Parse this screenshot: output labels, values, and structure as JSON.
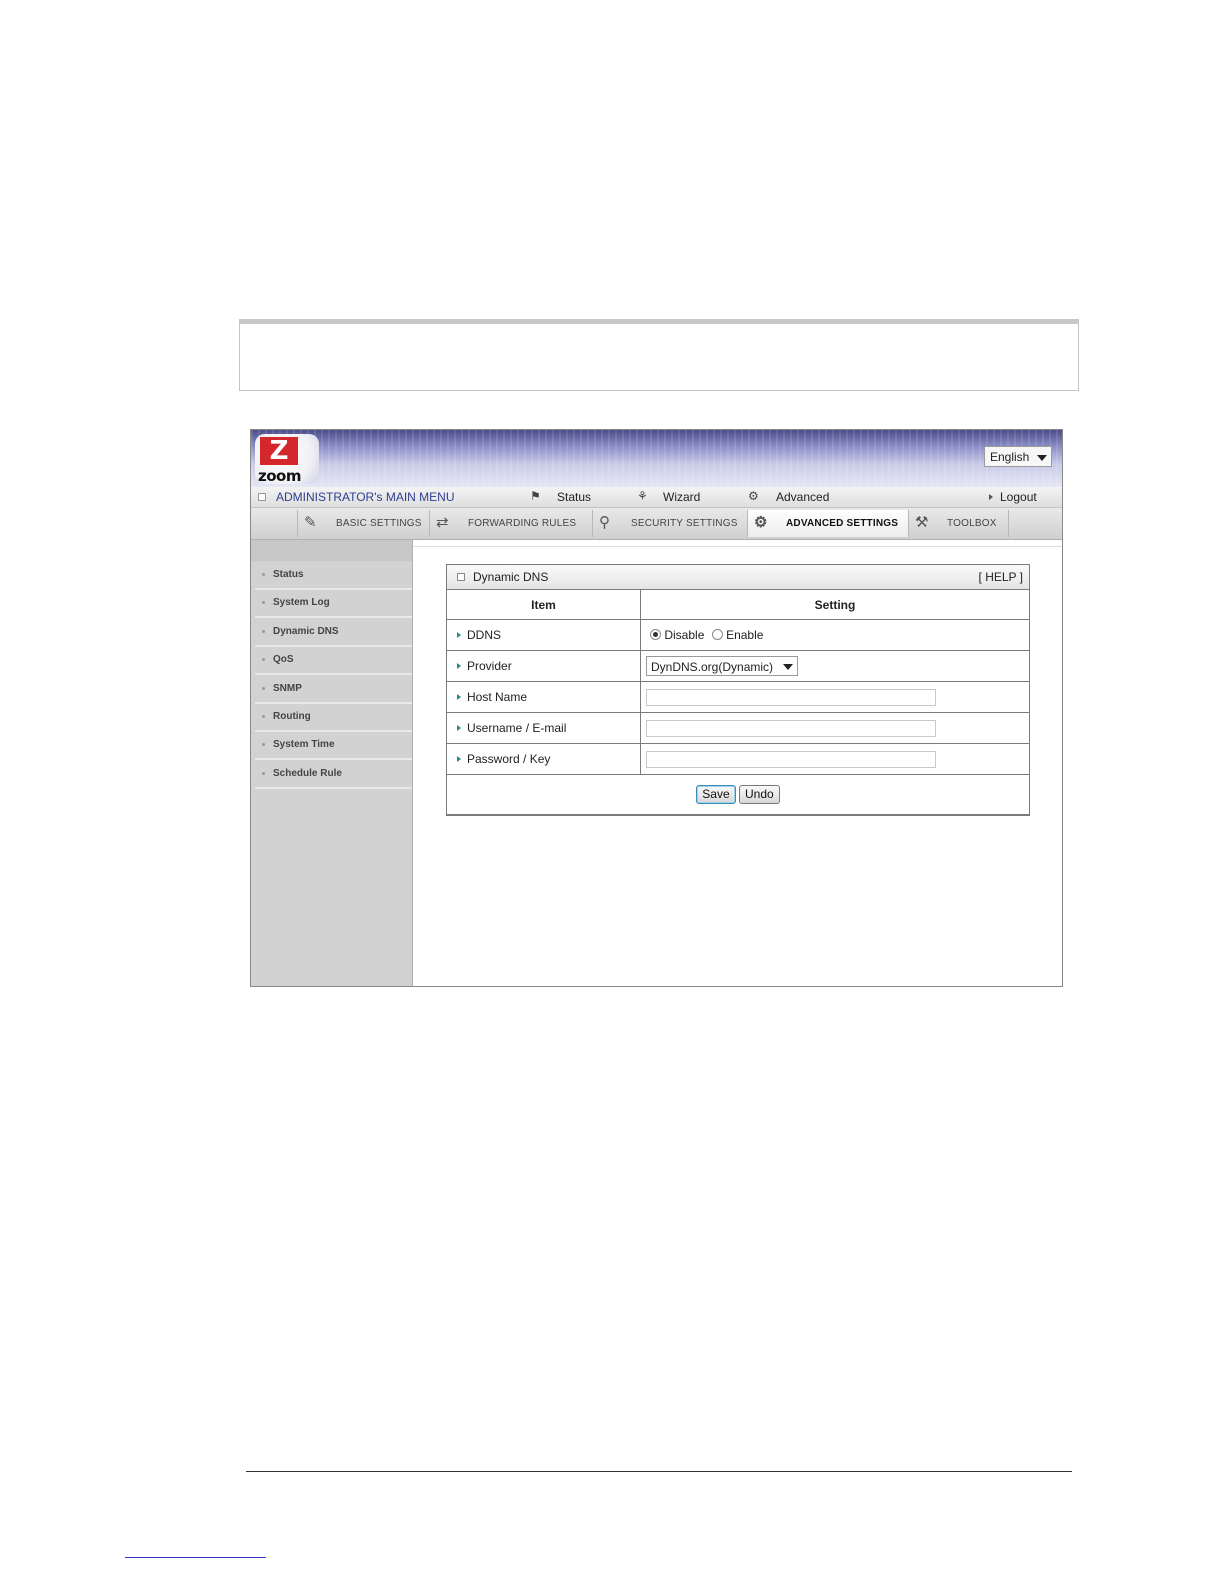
{
  "header": {
    "logo_text": "zoom",
    "language": "English"
  },
  "menu": {
    "title": "ADMINISTRATOR's MAIN MENU",
    "status": "Status",
    "wizard": "Wizard",
    "advanced": "Advanced",
    "logout": "Logout"
  },
  "tabs": [
    {
      "label": "BASIC SETTINGS",
      "icon": "basic-settings-icon"
    },
    {
      "label": "FORWARDING RULES",
      "icon": "forwarding-rules-icon"
    },
    {
      "label": "SECURITY SETTINGS",
      "icon": "security-settings-icon"
    },
    {
      "label": "ADVANCED SETTINGS",
      "icon": "advanced-settings-icon",
      "active": true
    },
    {
      "label": "TOOLBOX",
      "icon": "toolbox-icon"
    }
  ],
  "sidebar": {
    "items": [
      {
        "label": "Status"
      },
      {
        "label": "System Log"
      },
      {
        "label": "Dynamic DNS"
      },
      {
        "label": "QoS"
      },
      {
        "label": "SNMP"
      },
      {
        "label": "Routing"
      },
      {
        "label": "System Time"
      },
      {
        "label": "Schedule Rule"
      }
    ]
  },
  "panel": {
    "title": "Dynamic DNS",
    "help": "[ HELP ]",
    "col_item": "Item",
    "col_setting": "Setting",
    "rows": {
      "ddns": {
        "label": "DDNS",
        "options": [
          "Disable",
          "Enable"
        ],
        "selected": "Disable"
      },
      "provider": {
        "label": "Provider",
        "value": "DynDNS.org(Dynamic)"
      },
      "host_name": {
        "label": "Host Name",
        "value": ""
      },
      "username": {
        "label": "Username / E-mail",
        "value": ""
      },
      "password": {
        "label": "Password / Key",
        "value": ""
      }
    },
    "save_label": "Save",
    "undo_label": "Undo"
  },
  "colors": {
    "menu_title": "#2d3f91",
    "logo_red": "#d3272b",
    "row_marker": "#2b8a88"
  }
}
